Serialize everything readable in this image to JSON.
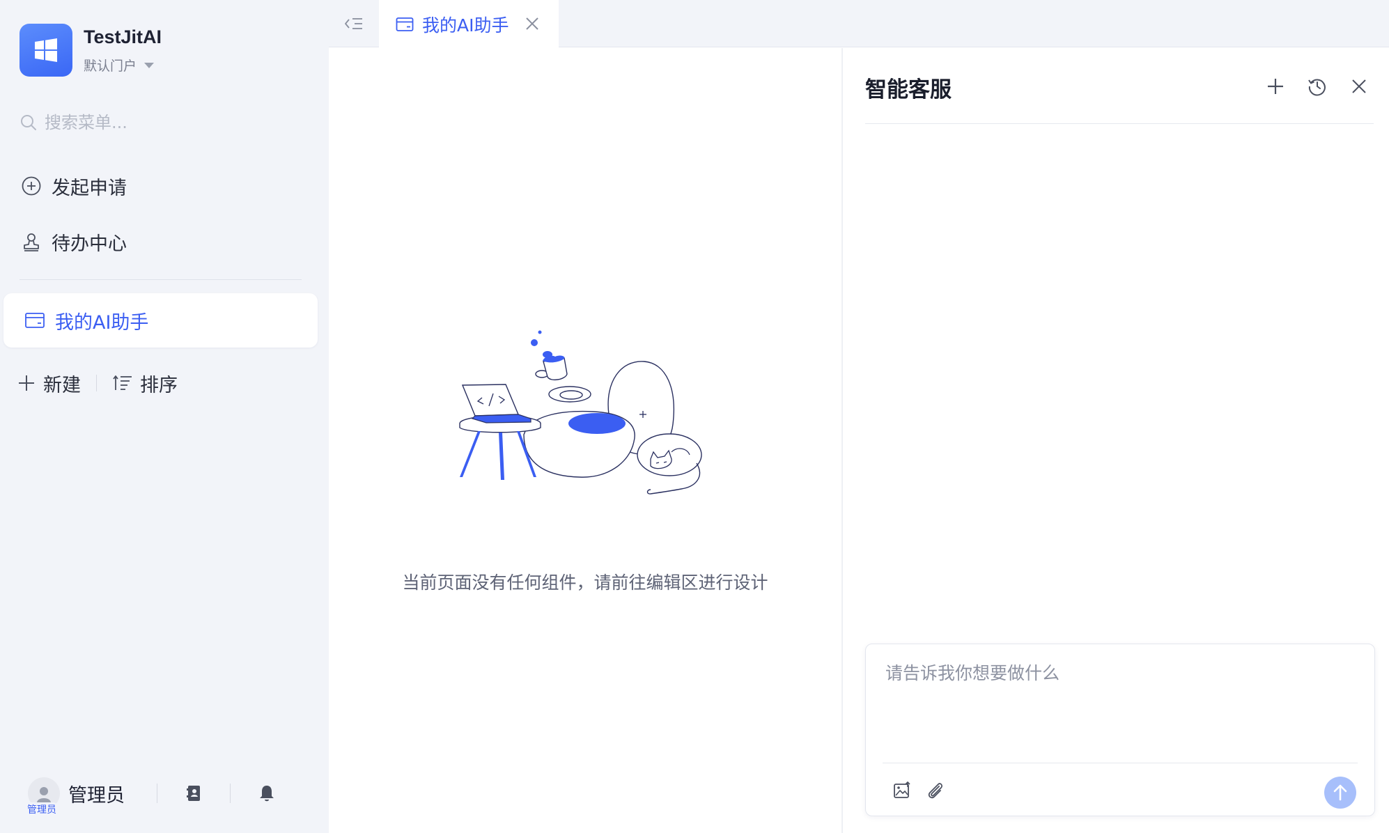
{
  "app": {
    "name": "TestJitAI",
    "portal": "默认门户"
  },
  "search": {
    "placeholder": "搜索菜单..."
  },
  "nav": {
    "items": [
      {
        "label": "发起申请",
        "icon": "plus-circle-icon"
      },
      {
        "label": "待办中心",
        "icon": "user-stamp-icon"
      }
    ],
    "active": {
      "label": "我的AI助手",
      "icon": "window-icon"
    }
  },
  "actions": {
    "new_label": "新建",
    "sort_label": "排序"
  },
  "footer": {
    "user_name": "管理员",
    "avatar_badge": "管理员"
  },
  "tab": {
    "label": "我的AI助手"
  },
  "canvas": {
    "empty_text": "当前页面没有任何组件，请前往编辑区进行设计"
  },
  "chat": {
    "title": "智能客服",
    "input_placeholder": "请告诉我你想要做什么"
  },
  "colors": {
    "accent": "#3b5ef2",
    "sidebar_bg": "#f2f4f9",
    "send_disabled": "#a7bffb"
  }
}
